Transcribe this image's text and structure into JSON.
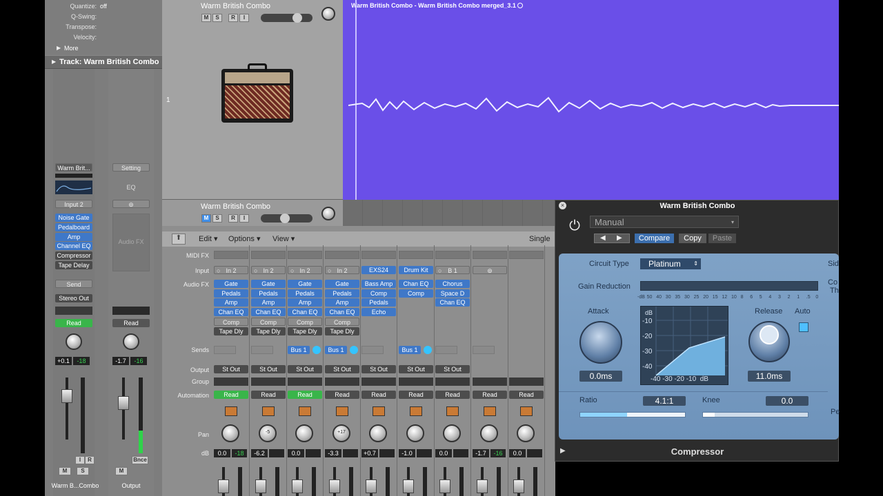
{
  "inspector": {
    "quantize_label": "Quantize:",
    "quantize_value": "off",
    "qswing_label": "Q-Swing:",
    "transpose_label": "Transpose:",
    "velocity_label": "Velocity:",
    "more_label": "More",
    "track_label": "Track:  Warm British Combo",
    "strip1": {
      "setting": "Warm Brit...",
      "input": "Input 2",
      "fx": [
        "Noise Gate",
        "Pedalboard",
        "Amp",
        "Channel EQ",
        "Compressor",
        "Tape Delay"
      ],
      "send": "Send",
      "output": "Stereo Out",
      "automation": "Read",
      "volume": "+0.1",
      "peak": "-18",
      "i_btn": "I",
      "r_btn": "R",
      "m_btn": "M",
      "s_btn": "S",
      "name": "Warm B...Combo"
    },
    "strip2": {
      "setting": "Setting",
      "eq": "EQ",
      "audio_fx": "Audio FX",
      "automation": "Read",
      "volume": "-1.7",
      "peak": "-16",
      "bnce": "Bnce",
      "m_btn": "M",
      "name": "Output"
    }
  },
  "tracks": [
    {
      "name": "Warm British Combo",
      "number": "1",
      "m": "M",
      "s": "S",
      "r": "R",
      "i": "I"
    },
    {
      "name": "Warm British Combo",
      "m": "M",
      "s": "S",
      "r": "R",
      "i": "I"
    }
  ],
  "region": {
    "title": "Warm British Combo - Warm British Combo merged_3.1"
  },
  "mixer": {
    "toolbar": {
      "edit": "Edit",
      "options": "Options",
      "view": "View",
      "single": "Single"
    },
    "row_labels": {
      "midi_fx": "MIDI FX",
      "input": "Input",
      "audio_fx": "Audio FX",
      "sends": "Sends",
      "output": "Output",
      "group": "Group",
      "automation": "Automation",
      "pan": "Pan",
      "db": "dB"
    },
    "channels": [
      {
        "input": "In 2",
        "fx": [
          "Gate",
          "Pedals",
          "Amp",
          "Chan EQ",
          "Comp",
          "Tape Dly"
        ],
        "send": "",
        "output": "St Out",
        "automation": "Read",
        "auto_green": true,
        "pan": "",
        "db": "0.0",
        "peak": "-18"
      },
      {
        "input": "In 2",
        "fx": [
          "Gate",
          "Pedals",
          "Amp",
          "Chan EQ",
          "Comp",
          "Tape Dly"
        ],
        "send": "",
        "output": "St Out",
        "automation": "Read",
        "auto_green": false,
        "pan": "-5",
        "db": "-6.2",
        "peak": ""
      },
      {
        "input": "In 2",
        "fx": [
          "Gate",
          "Pedals",
          "Amp",
          "Chan EQ",
          "Comp",
          "Tape Dly"
        ],
        "send": "Bus 1",
        "output": "St Out",
        "automation": "Read",
        "auto_green": true,
        "pan": "",
        "db": "0.0",
        "peak": ""
      },
      {
        "input": "In 2",
        "fx": [
          "Gate",
          "Pedals",
          "Amp",
          "Chan EQ",
          "Comp",
          "Tape Dly"
        ],
        "send": "Bus 1",
        "output": "St Out",
        "automation": "Read",
        "auto_green": false,
        "pan": "+17",
        "db": "-3.3",
        "peak": ""
      },
      {
        "input": "EXS24",
        "fx": [
          "Bass Amp",
          "Comp",
          "Pedals",
          "Echo"
        ],
        "send": "",
        "output": "St Out",
        "automation": "Read",
        "auto_green": false,
        "pan": "",
        "db": "+0.7",
        "peak": ""
      },
      {
        "input": "Drum Kit",
        "fx": [
          "Chan EQ",
          "Comp"
        ],
        "send": "Bus 1",
        "output": "St Out",
        "automation": "Read",
        "auto_green": false,
        "pan": "",
        "db": "-1.0",
        "peak": ""
      },
      {
        "input": "B 1",
        "fx": [
          "Chorus",
          "Space D",
          "Chan EQ"
        ],
        "send": "",
        "output": "St Out",
        "automation": "Read",
        "auto_green": false,
        "pan": "",
        "db": "0.0",
        "peak": ""
      },
      {
        "input": "",
        "fx": [],
        "send": "",
        "output": "",
        "automation": "Read",
        "auto_green": false,
        "pan": "",
        "db": "-1.7",
        "peak": "-16"
      },
      {
        "input": "",
        "fx": [],
        "send": "",
        "output": "",
        "automation": "Read",
        "auto_green": false,
        "pan": "",
        "db": "0.0",
        "peak": ""
      }
    ]
  },
  "plugin": {
    "window_title": "Warm British Combo",
    "preset": "Manual",
    "compare": "Compare",
    "copy": "Copy",
    "paste": "Paste",
    "circuit_type_label": "Circuit Type",
    "circuit_type_value": "Platinum",
    "side_label": "Sid",
    "gain_reduction_label": "Gain Reduction",
    "gr_scale": [
      "-dB",
      "50",
      "40",
      "30",
      "35",
      "30",
      "25",
      "20",
      "15",
      "12",
      "10",
      "8",
      "6",
      "5",
      "4",
      "3",
      "2",
      "1",
      ".5",
      "0"
    ],
    "co_label": "Co",
    "th_label": "Th",
    "attack_label": "Attack",
    "attack_value": "0.0ms",
    "release_label": "Release",
    "release_value": "11.0ms",
    "auto_label": "Auto",
    "graph_db": "dB",
    "graph_y": [
      "-10",
      "-20",
      "-30",
      "-40"
    ],
    "graph_x": "-40 -30 -20 -10  dB",
    "ratio_label": "Ratio",
    "ratio_value": "4.1:1",
    "knee_label": "Knee",
    "knee_value": "0.0",
    "pe_label": "Pe",
    "footer": "Compressor",
    "ratio_fill": 0.45,
    "knee_fill": 0.05
  }
}
